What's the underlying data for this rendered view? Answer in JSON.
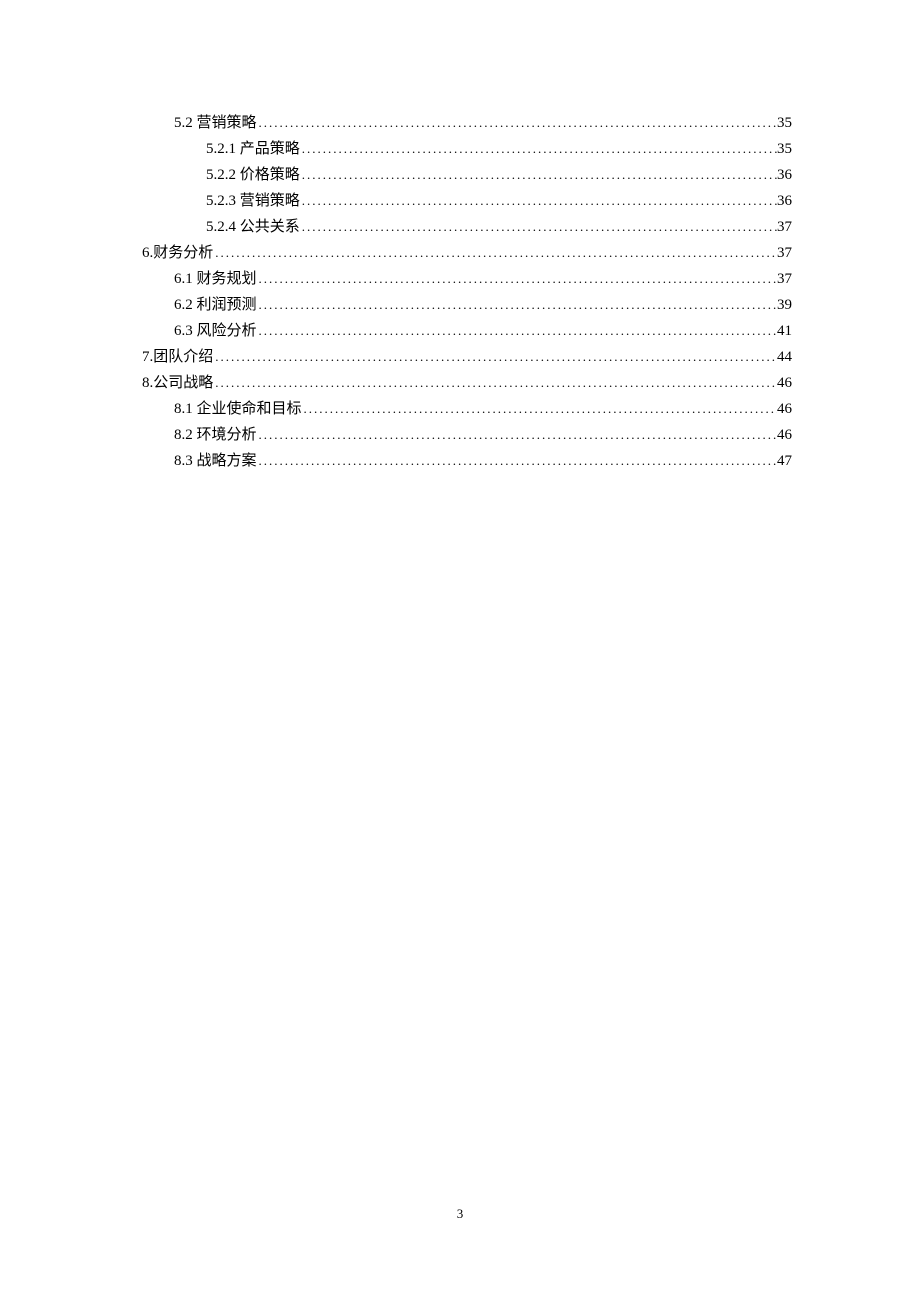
{
  "toc": [
    {
      "level": 2,
      "label": "5.2 营销策略",
      "page": "35"
    },
    {
      "level": 3,
      "label": "5.2.1  产品策略",
      "page": "35"
    },
    {
      "level": 3,
      "label": "5.2.2  价格策略",
      "page": "36"
    },
    {
      "level": 3,
      "label": "5.2.3  营销策略",
      "page": "36"
    },
    {
      "level": 3,
      "label": "5.2.4  公共关系",
      "page": "37"
    },
    {
      "level": 1,
      "label": "6.财务分析",
      "page": "37"
    },
    {
      "level": 2,
      "label": "6.1 财务规划",
      "page": "37"
    },
    {
      "level": 2,
      "label": "6.2 利润预测",
      "page": "39"
    },
    {
      "level": 2,
      "label": "6.3 风险分析",
      "page": "41"
    },
    {
      "level": 1,
      "label": "7.团队介绍",
      "page": "44"
    },
    {
      "level": 1,
      "label": "8.公司战略",
      "page": "46"
    },
    {
      "level": 2,
      "label": "8.1 企业使命和目标",
      "page": "46"
    },
    {
      "level": 2,
      "label": "8.2 环境分析",
      "page": "46"
    },
    {
      "level": 2,
      "label": "8.3 战略方案",
      "page": "47"
    }
  ],
  "page_number": "3"
}
